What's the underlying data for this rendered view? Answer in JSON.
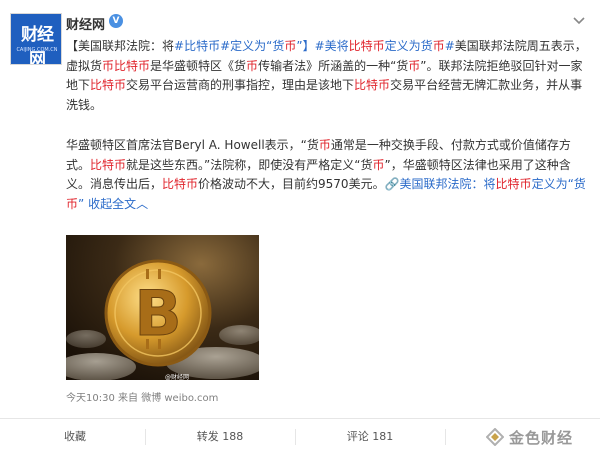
{
  "post": {
    "author": "财经网",
    "avatar_text": "财经网",
    "avatar_subtext": "CAIJING.COM.CN",
    "verified_mark": "V",
    "paragraph1": {
      "p1": "【美国联邦法院：将",
      "t1": "#比特币",
      "p2": "#定义为“货",
      "t2": "币",
      "p3": "”】",
      "t3": "#美将",
      "t4": "比特币",
      "t5": "定义为货",
      "t6": "币",
      "t7": "#",
      "p4": "美国联邦法院周五表示，虚拟货",
      "t8": "币比特币",
      "p5": "是华盛顿特区《货",
      "t9": "币",
      "p6": "传输者法》所涵盖的一种“货",
      "t10": "币",
      "p7": "”。联邦法院拒绝驳回针对一家地下",
      "t11": "比特币",
      "p8": "交易平台运营商的刑事指控，理由是该地下",
      "t12": "比特币",
      "p9": "交易平台经营无牌汇款业务，并从事洗钱。"
    },
    "paragraph2": {
      "p1": "华盛顿特区首席法官Beryl A.  Howell表示，“货",
      "t1": "币",
      "p2": "通常是一种交换手段、付款方式或价值储存方式。",
      "t2": "比特币",
      "p3": "就是这些东西。”法院称，即使没有严格定义“货",
      "t3": "币",
      "p4": "”，华盛顿特区法律也采用了这种含义。消息传出后，",
      "t4": "比特币",
      "p5": "价格波动不大，目前约9570美元。",
      "link_icon": "🔗",
      "link1": "美国联邦法院：将",
      "link2": "比特币",
      "link3": "定义为“货",
      "link4": "币",
      "link5": "”",
      "collapse": "收起全文",
      "collapse_arrow": "︿"
    },
    "photo_credit": "@财经网",
    "meta": {
      "time": "今天10:30",
      "source_prefix": "来自",
      "source": "微博 weibo.com"
    }
  },
  "actions": {
    "favorite": "收藏",
    "repost": "转发 188",
    "comment": "评论 181"
  },
  "watermark": {
    "text": "金色财经"
  },
  "icons": {
    "verified": "verified-badge-icon",
    "menu": "chevron-down-icon",
    "link": "link-icon",
    "watermark_logo": "jinse-logo-icon",
    "like": "thumbs-up-icon"
  },
  "colors": {
    "topic_link": "#2b6bc9",
    "highlight": "#e0242c",
    "verified": "#4a90e2",
    "avatar_bg": "#1f5fbf"
  }
}
